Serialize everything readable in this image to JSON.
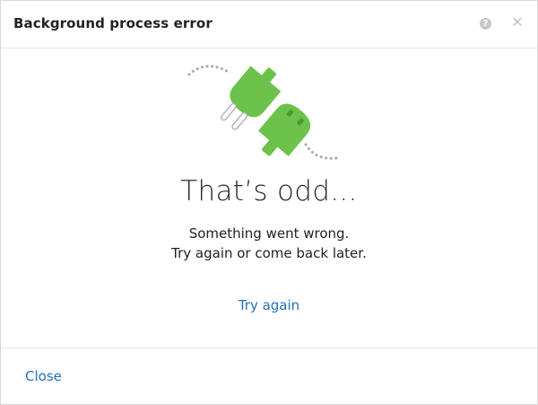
{
  "dialog": {
    "title": "Background process error",
    "help_icon": "question-circle-icon",
    "close_icon": "close-x-icon"
  },
  "main": {
    "illustration": "unplugged-plug-icon",
    "heading": "That’s odd...",
    "message_line1": "Something went wrong.",
    "message_line2": "Try again or come back later.",
    "retry_label": "Try again"
  },
  "footer": {
    "close_label": "Close"
  },
  "colors": {
    "plug_green": "#6cc24a",
    "link_blue": "#1f73b7",
    "dots_gray": "#a8a8a8"
  }
}
